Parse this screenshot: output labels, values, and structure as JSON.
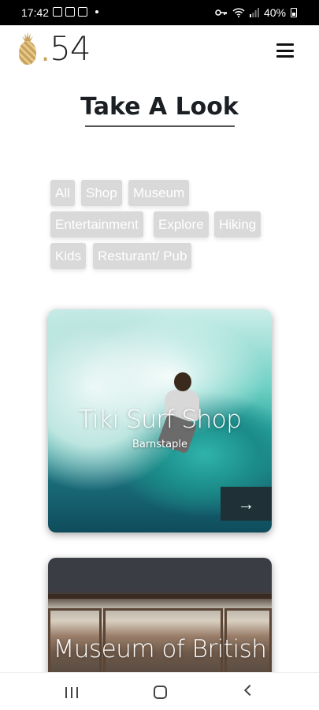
{
  "status_bar": {
    "time": "17:42",
    "battery": "40%"
  },
  "header": {
    "logo_dot": ".",
    "logo_number": "54"
  },
  "page": {
    "title": "Take A Look"
  },
  "filters": [
    "All",
    "Shop",
    "Museum",
    "Entertainment",
    "Explore",
    "Hiking",
    "Kids",
    "Resturant/ Pub"
  ],
  "cards": [
    {
      "title": "Tiki Surf Shop",
      "subtitle": "Barnstaple",
      "arrow": "→"
    },
    {
      "title": "Museum of British"
    }
  ]
}
